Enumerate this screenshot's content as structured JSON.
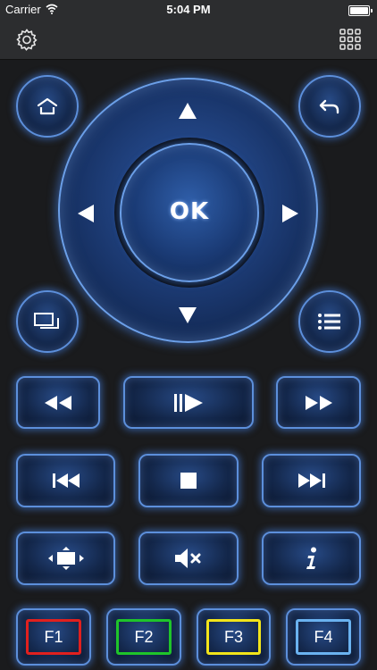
{
  "status_bar": {
    "carrier": "Carrier",
    "time": "5:04 PM"
  },
  "toolbar": {
    "settings_icon": "gear-icon",
    "layout_icon": "grid-icon"
  },
  "dpad": {
    "ok_label": "OK"
  },
  "function_keys": [
    {
      "label": "F1",
      "color": "#e0201e"
    },
    {
      "label": "F2",
      "color": "#1fc42a"
    },
    {
      "label": "F3",
      "color": "#f2e41a"
    },
    {
      "label": "F4",
      "color": "#6ab2f0"
    }
  ],
  "accent_color": "#5c8fdb"
}
